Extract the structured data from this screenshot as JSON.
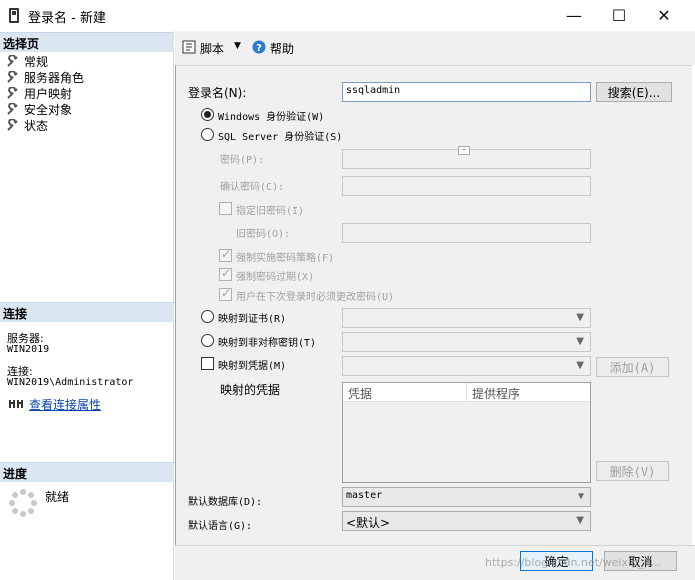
{
  "window": {
    "title": "登录名 - 新建",
    "minimize": "—",
    "maximize": "☐",
    "close": "✕"
  },
  "left": {
    "select_page_header": "选择页",
    "pages": [
      "常规",
      "服务器角色",
      "用户映射",
      "安全对象",
      "状态"
    ],
    "connection_header": "连接",
    "server_label": "服务器:",
    "server_value": "WIN2019",
    "connection_label": "连接:",
    "connection_value": "WIN2019\\Administrator",
    "view_conn_props": "查看连接属性",
    "progress_header": "进度",
    "progress_status": "就绪"
  },
  "toolbar": {
    "script_label": "脚本",
    "help_label": "帮助"
  },
  "form": {
    "login_name_label": "登录名(N):",
    "login_name_value": "ssqladmin",
    "search_button": "搜索(E)...",
    "windows_auth": "Windows 身份验证(W)",
    "sql_auth": "SQL Server 身份验证(S)",
    "password_label": "密码(P):",
    "confirm_password_label": "确认密码(C):",
    "specify_old_password": "指定旧密码(I)",
    "old_password_label": "旧密码(O):",
    "enforce_policy": "强制实施密码策略(F)",
    "enforce_expiration": "强制密码过期(X)",
    "must_change": "用户在下次登录时必须更改密码(U)",
    "map_certificate": "映射到证书(R)",
    "map_asym_key": "映射到非对称密钥(T)",
    "map_credential": "映射到凭据(M)",
    "add_button": "添加(A)",
    "mapped_credentials_label": "映射的凭据",
    "grid_col_credential": "凭据",
    "grid_col_provider": "提供程序",
    "remove_button": "删除(V)",
    "default_db_label": "默认数据库(D):",
    "default_db_value": "master",
    "default_lang_label": "默认语言(G):",
    "default_lang_value": "<默认>"
  },
  "footer": {
    "ok_button": "确定",
    "cancel_button": "取消",
    "watermark": "https://blog.csdn.net/weixin_4..."
  }
}
